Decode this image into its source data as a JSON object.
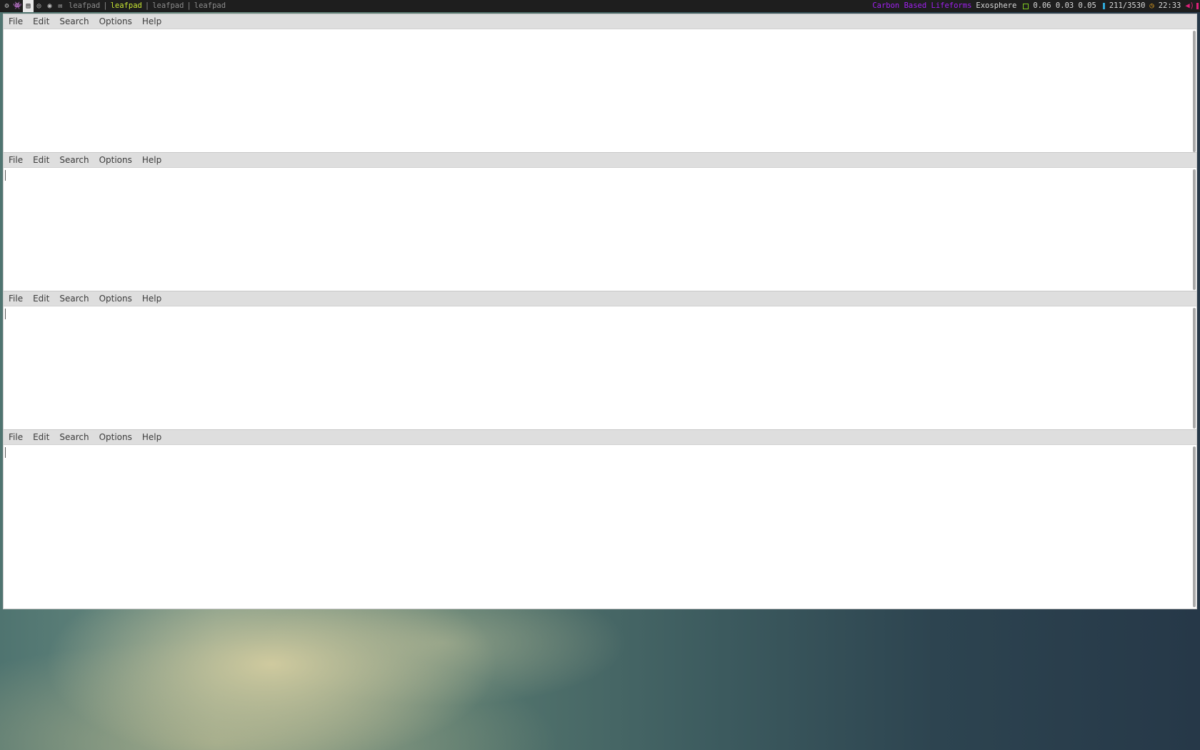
{
  "topbar": {
    "windows": [
      "leafpad",
      "leafpad",
      "leafpad",
      "leafpad"
    ],
    "focused_window": 1,
    "separator": "|",
    "now_playing_artist": "Carbon Based Lifeforms",
    "now_playing_track": "Exosphere",
    "load_avg": "0.06 0.03 0.05",
    "memory": "211/3530",
    "clock": "22:33",
    "colors": {
      "artist": "#a020f0",
      "focused": "#c8e632",
      "load_icon": "#7ec820",
      "mem_icon": "#2ea8d8",
      "clock_icon": "#e0a020",
      "volume_icon": "#e0207a"
    }
  },
  "menu": {
    "file": "File",
    "edit": "Edit",
    "search": "Search",
    "options": "Options",
    "help": "Help"
  }
}
